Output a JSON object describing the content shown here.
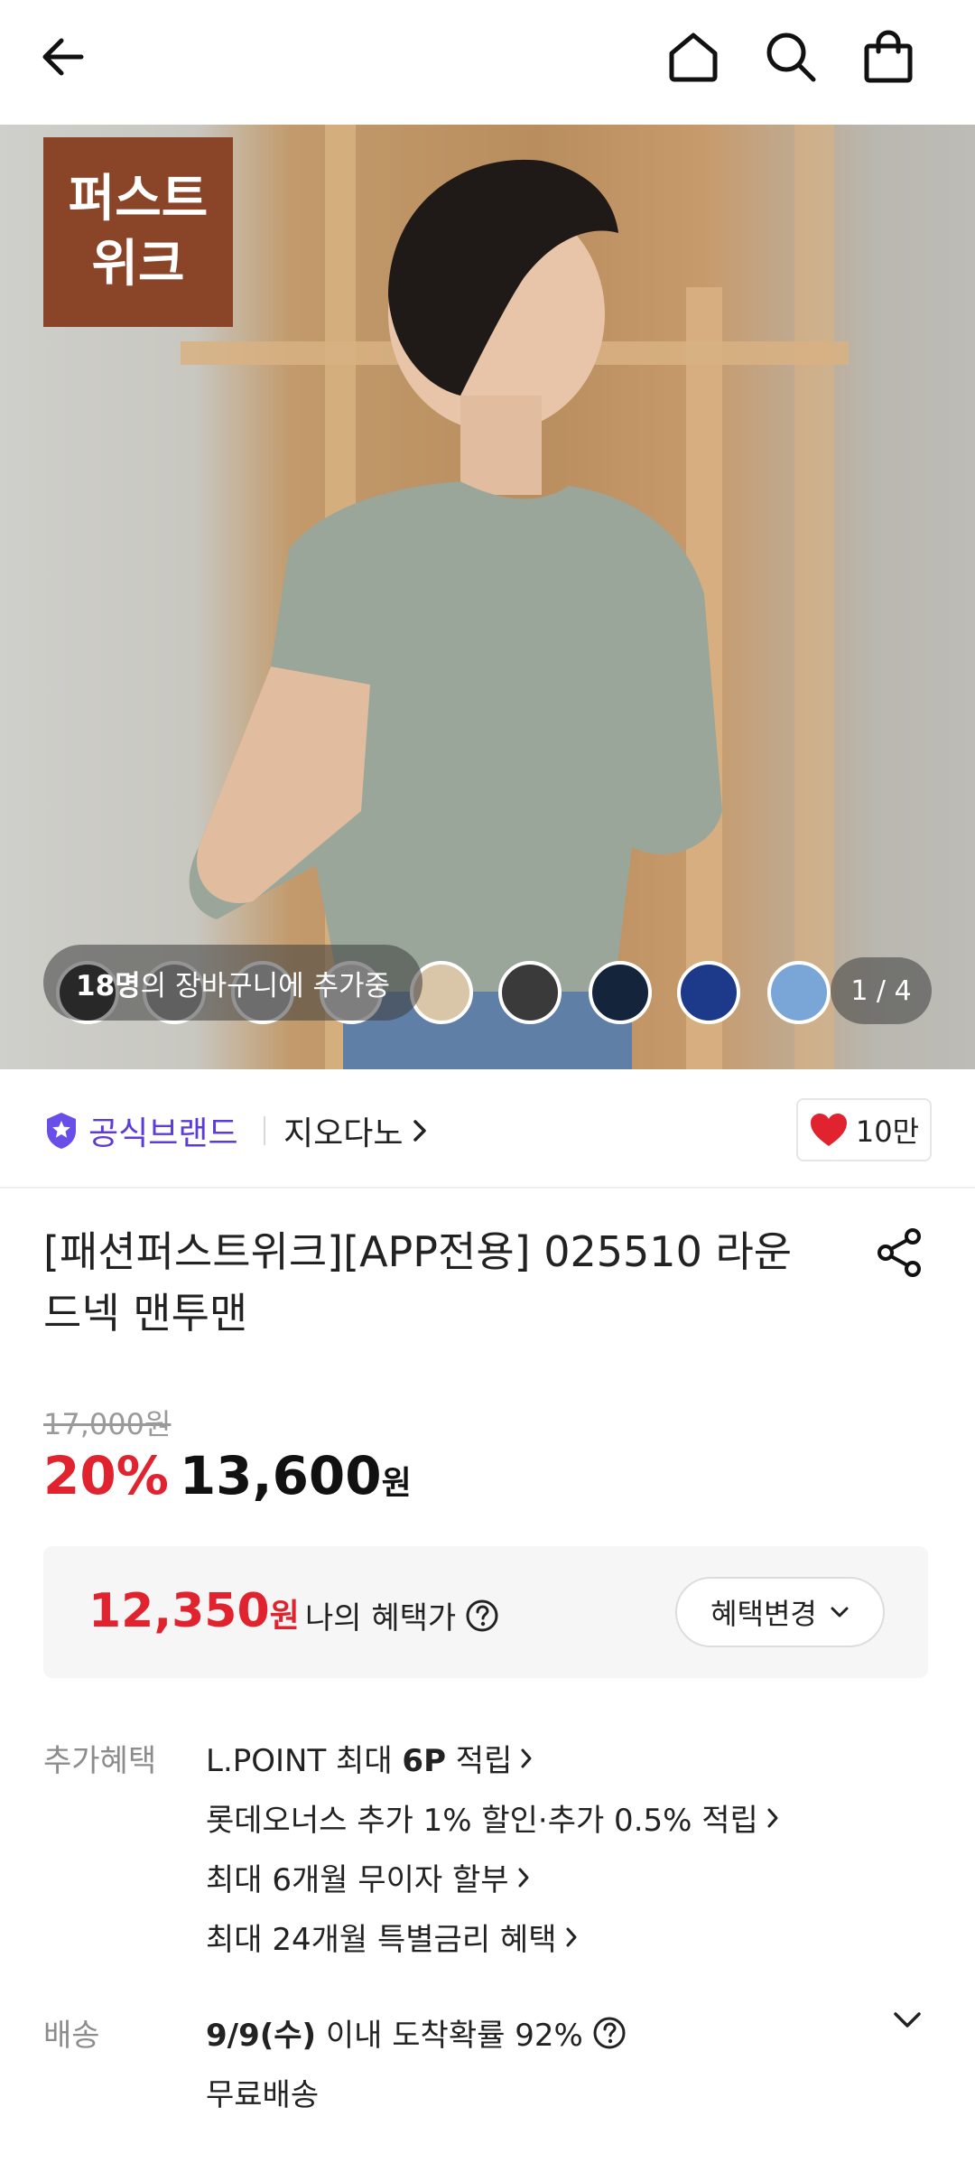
{
  "header": {
    "back_icon": "arrow-left-icon",
    "home_icon": "home-icon",
    "search_icon": "search-icon",
    "cart_icon": "shopping-bag-icon"
  },
  "hero": {
    "badge_line1": "퍼스트",
    "badge_line2": "위크",
    "cart_count": "18명",
    "cart_text": "의 장바구니에 추가중",
    "pager": "1 / 4",
    "swatches": [
      "#111111",
      "#8c8c8c",
      "#a9a9a9",
      "#cfcfcf",
      "#d9c6a8",
      "#3a3a3a",
      "#14243a",
      "#1d3a8a",
      "#79a6d6"
    ]
  },
  "brand": {
    "official_label": "공식브랜드",
    "brand_name": "지오다노",
    "like_count": "10만"
  },
  "product": {
    "title": "[패션퍼스트위크][APP전용] 025510 라운드넥 맨투맨",
    "original_price": "17,000원",
    "discount": "20%",
    "price": "13,600",
    "price_unit": "원"
  },
  "benefit": {
    "price": "12,350",
    "price_unit": "원",
    "label": "나의 혜택가",
    "change_button": "혜택변경"
  },
  "extra": {
    "label": "추가혜택",
    "item1_prefix": "L.POINT 최대 ",
    "item1_bold": "6P",
    "item1_suffix": " 적립",
    "item2": "롯데오너스 추가 1% 할인·추가 0.5% 적립",
    "item3": "최대 6개월 무이자 할부",
    "item4": "최대 24개월 특별금리 혜택"
  },
  "shipping": {
    "label": "배송",
    "date": "9/9(수)",
    "date_suffix": " 이내 도착확률 92%",
    "fee": "무료배송"
  },
  "colors": {
    "accent_red": "#e0232e",
    "official_purple": "#5b3bd9",
    "badge_brown": "#8a4427"
  }
}
